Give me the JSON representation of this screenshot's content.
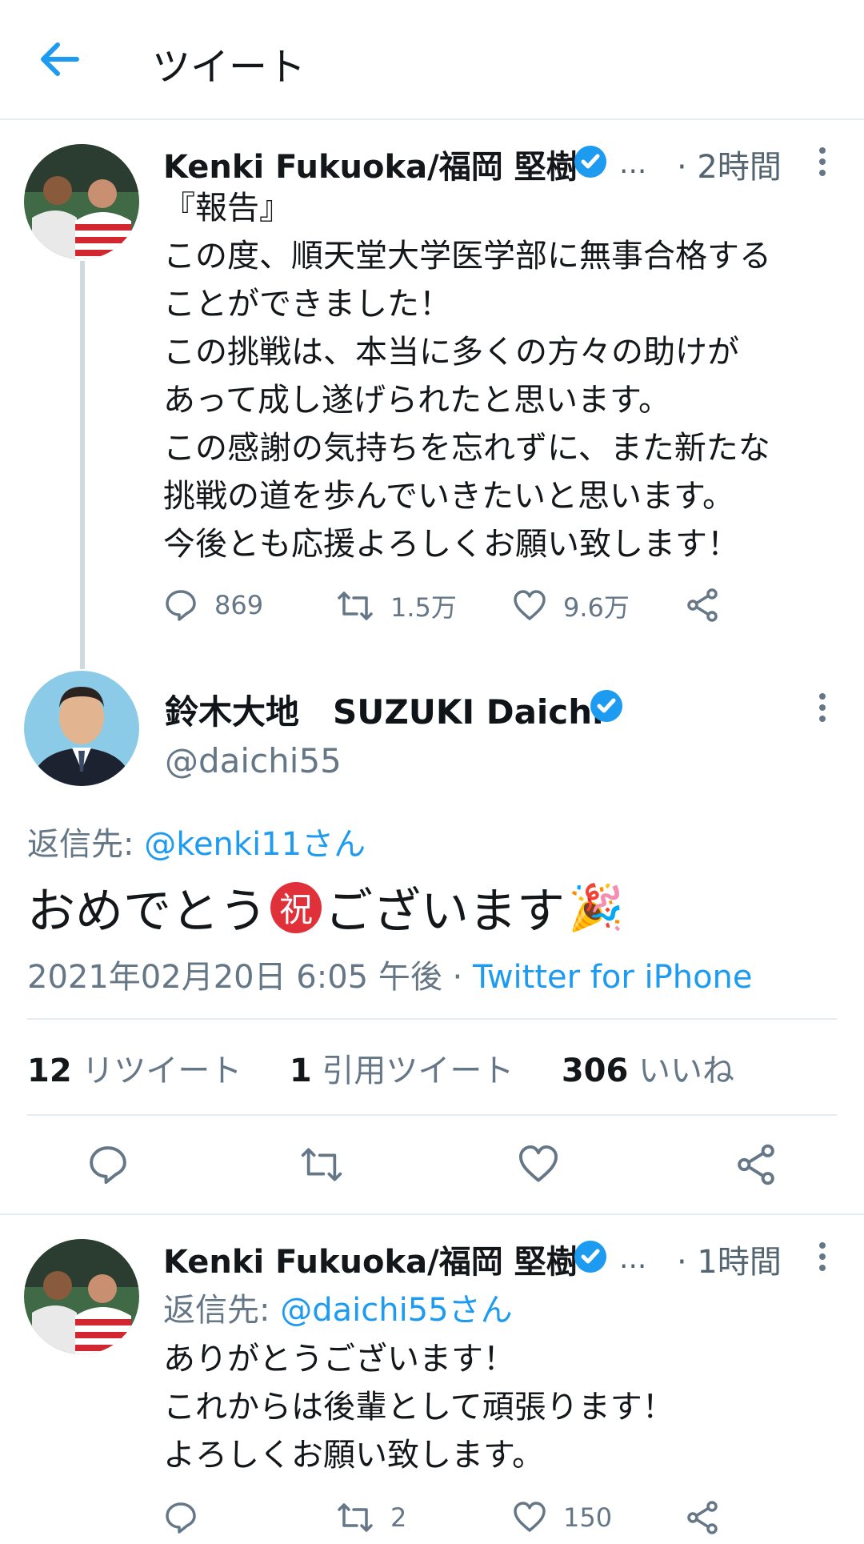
{
  "header": {
    "title": "ツイート"
  },
  "tweet1": {
    "name": "Kenki Fukuoka/福岡 堅樹",
    "ellipsis": "...",
    "time": "· 2時間",
    "body": "『報告』\nこの度、順天堂大学医学部に無事合格する\nことができました！\nこの挑戦は、本当に多くの方々の助けが\nあって成し遂げられたと思います。\nこの感謝の気持ちを忘れずに、また新たな\n挑戦の道を歩んでいきたいと思います。\n今後とも応援よろしくお願い致します！",
    "replies": "869",
    "retweets": "1.5万",
    "likes": "9.6万"
  },
  "main": {
    "name": "鈴木大地　SUZUKI Daichi",
    "handle": "@daichi55",
    "reply_prefix": "返信先: ",
    "reply_target": "@kenki11さん",
    "text_before": "おめでとう",
    "emoji_iwai": "祝",
    "text_after": "ございます",
    "emoji_party": "🎉",
    "timestamp": "2021年02月20日 6:05 午後 · ",
    "client": "Twitter for iPhone",
    "retweet_count": "12",
    "retweet_label": " リツイート",
    "quote_count": "1",
    "quote_label": " 引用ツイート",
    "like_count": "306",
    "like_label": " いいね"
  },
  "tweet2": {
    "name": "Kenki Fukuoka/福岡 堅樹",
    "ellipsis": "...",
    "time": "· 1時間",
    "reply_prefix": "返信先: ",
    "reply_target": "@daichi55さん",
    "body": "ありがとうございます！\nこれからは後輩として頑張ります！\nよろしくお願い致します。",
    "replies": "",
    "retweets": "2",
    "likes": "150"
  },
  "colors": {
    "accent": "#1d9bf0",
    "muted": "#657786",
    "divider": "#e6ecf0"
  }
}
